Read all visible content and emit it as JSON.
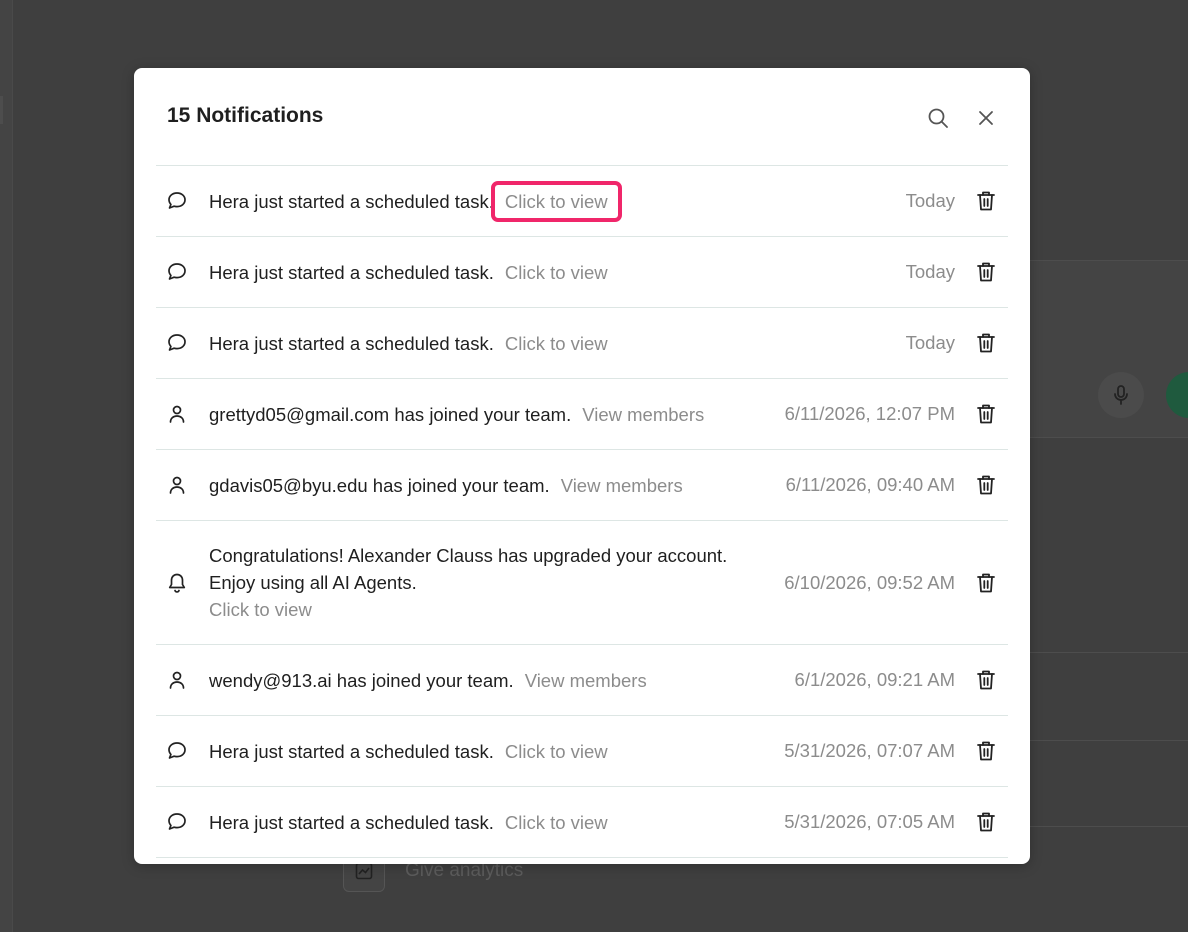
{
  "background": {
    "sidebar_item_label": "Give analytics"
  },
  "modal": {
    "title": "15 Notifications",
    "search_icon": "search-icon",
    "close_icon": "close-icon"
  },
  "notifications": [
    {
      "icon": "chat-bubble-icon",
      "text": "Hera just started a scheduled task.",
      "link": "Click to view",
      "date": "Today",
      "highlighted": true
    },
    {
      "icon": "chat-bubble-icon",
      "text": "Hera just started a scheduled task.",
      "link": "Click to view",
      "date": "Today"
    },
    {
      "icon": "chat-bubble-icon",
      "text": "Hera just started a scheduled task.",
      "link": "Click to view",
      "date": "Today"
    },
    {
      "icon": "user-icon",
      "text": "grettyd05@gmail.com has joined your team.",
      "link": "View members",
      "date": "6/11/2026, 12:07 PM"
    },
    {
      "icon": "user-icon",
      "text": "gdavis05@byu.edu has joined your team.",
      "link": "View members",
      "date": "6/11/2026, 09:40 AM"
    },
    {
      "icon": "bell-icon",
      "text": "Congratulations! Alexander Clauss has upgraded your account. Enjoy using all AI Agents.",
      "link": "Click to view",
      "date": "6/10/2026, 09:52 AM"
    },
    {
      "icon": "user-icon",
      "text": "wendy@913.ai has joined your team.",
      "link": "View members",
      "date": "6/1/2026, 09:21 AM"
    },
    {
      "icon": "chat-bubble-icon",
      "text": "Hera just started a scheduled task.",
      "link": "Click to view",
      "date": "5/31/2026, 07:07 AM"
    },
    {
      "icon": "chat-bubble-icon",
      "text": "Hera just started a scheduled task.",
      "link": "Click to view",
      "date": "5/31/2026, 07:05 AM"
    }
  ],
  "colors": {
    "overlay": "#3f3f3f",
    "highlight": "#f0266a",
    "muted_text": "#8c8c8c",
    "divider": "#dde6e4"
  }
}
